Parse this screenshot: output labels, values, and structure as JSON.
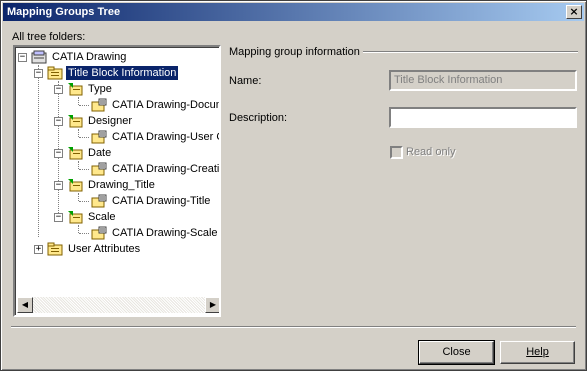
{
  "window": {
    "title": "Mapping Groups Tree"
  },
  "tree_label": "All  tree folders:",
  "tree": {
    "items": [
      {
        "label": "CATIA Drawing",
        "icon": "catia-drawing-icon"
      },
      {
        "label": "Title Block Information",
        "icon": "folder-icon",
        "selected": true
      },
      {
        "label": "Type",
        "icon": "green-folder-icon"
      },
      {
        "label": "CATIA Drawing-Document",
        "icon": "attribute-icon"
      },
      {
        "label": "Designer",
        "icon": "green-folder-icon"
      },
      {
        "label": "CATIA Drawing-User Operator",
        "icon": "attribute-icon"
      },
      {
        "label": "Date",
        "icon": "green-folder-icon"
      },
      {
        "label": "CATIA Drawing-Creation",
        "icon": "attribute-icon"
      },
      {
        "label": "Drawing_Title",
        "icon": "green-folder-icon"
      },
      {
        "label": "CATIA Drawing-Title",
        "icon": "attribute-icon"
      },
      {
        "label": "Scale",
        "icon": "green-folder-icon"
      },
      {
        "label": "CATIA Drawing-Scale",
        "icon": "attribute-icon"
      },
      {
        "label": "User Attributes",
        "icon": "folder-icon"
      }
    ]
  },
  "group": {
    "heading": "Mapping group information",
    "name_label": "Name:",
    "name_value": "Title Block Information",
    "description_label": "Description:",
    "description_value": "",
    "readonly_label": "Read only"
  },
  "buttons": {
    "close": "Close",
    "help": "Help"
  },
  "colors": {
    "titlebar": "#0a246a",
    "selection": "#0a246a",
    "face": "#d4d0c8"
  }
}
